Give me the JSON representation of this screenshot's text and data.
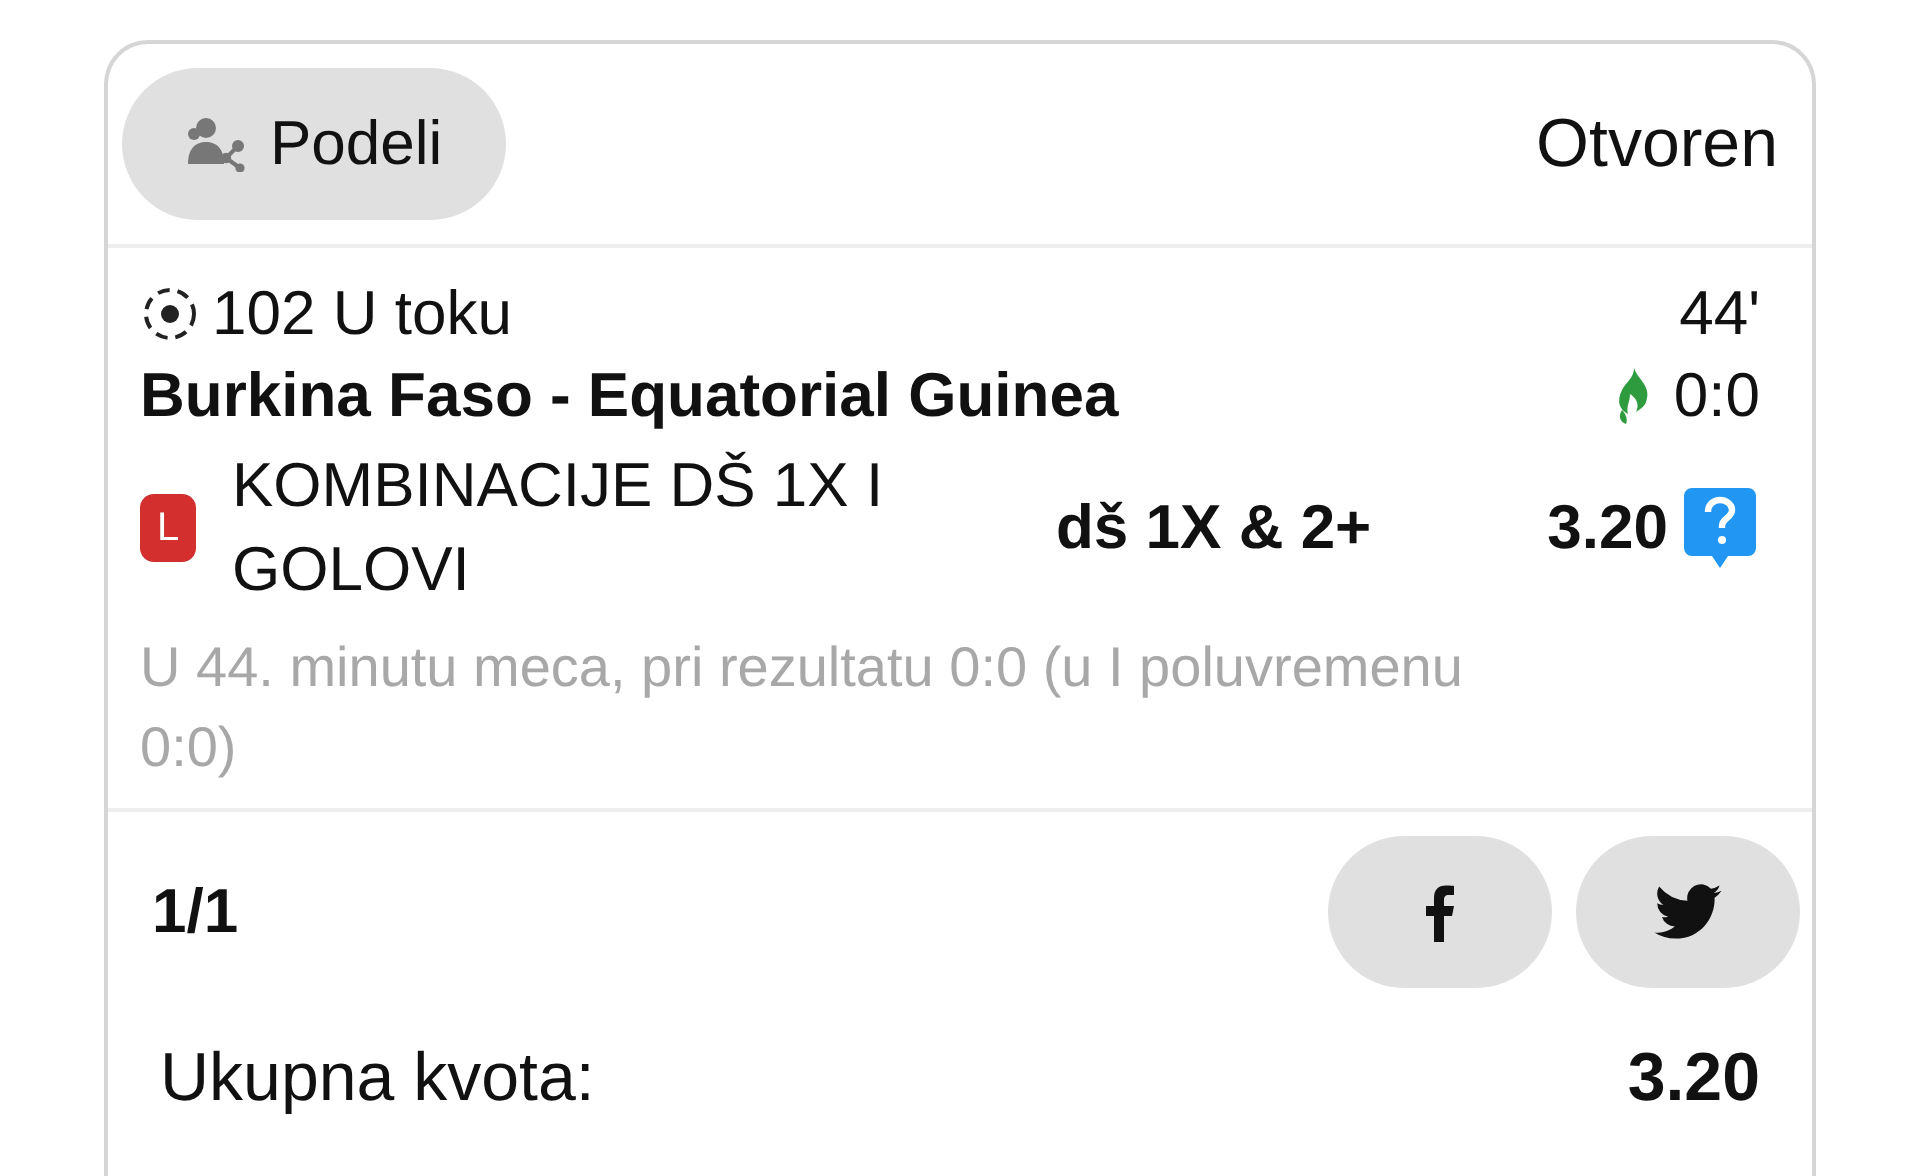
{
  "header": {
    "share_button": "Podeli",
    "status": "Otvoren"
  },
  "match": {
    "status": "102 U toku",
    "minute": "44'",
    "teams": "Burkina Faso - Equatorial Guinea",
    "score": "0:0"
  },
  "bet": {
    "badge": "L",
    "market": "KOMBINACIJE DŠ 1X I GOLOVI",
    "pick": "dš 1X & 2+",
    "odds": "3.20",
    "description": "U 44. minutu meca, pri rezultatu 0:0 (u I poluvremenu 0:0)"
  },
  "footer": {
    "count": "1/1"
  },
  "total": {
    "label": "Ukupna kvota:",
    "value": "3.20"
  }
}
